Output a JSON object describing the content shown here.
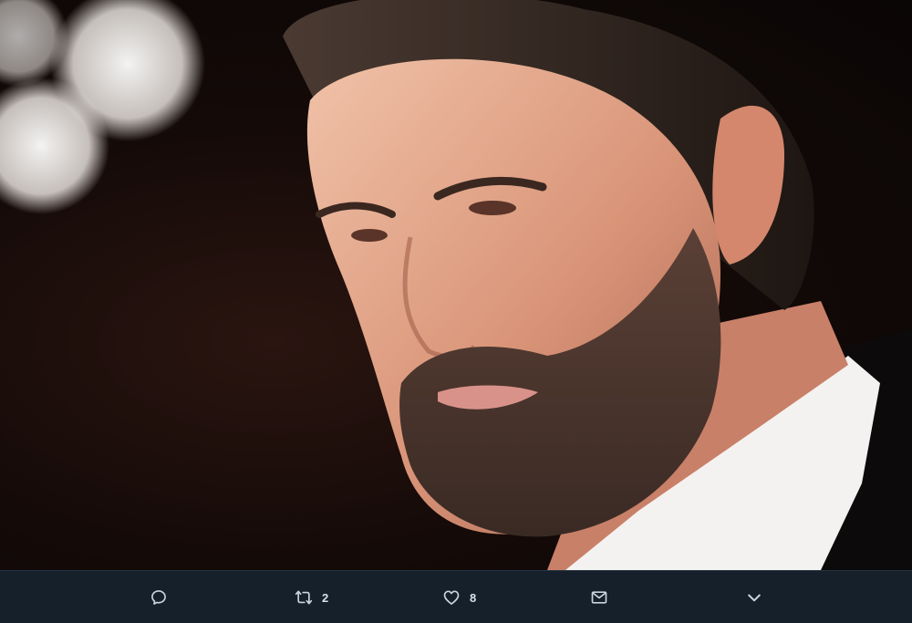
{
  "photo": {
    "description_icon": "photo-portrait"
  },
  "actions": {
    "reply": {
      "icon": "reply-icon"
    },
    "retweet": {
      "icon": "retweet-icon",
      "count": "2"
    },
    "like": {
      "icon": "heart-icon",
      "count": "8"
    },
    "dm": {
      "icon": "envelope-icon"
    },
    "more": {
      "icon": "chevron-down-icon"
    }
  },
  "colors": {
    "bar_background": "#15202b",
    "icon_color": "#8899a6",
    "count_color": "#d9e0e6"
  }
}
